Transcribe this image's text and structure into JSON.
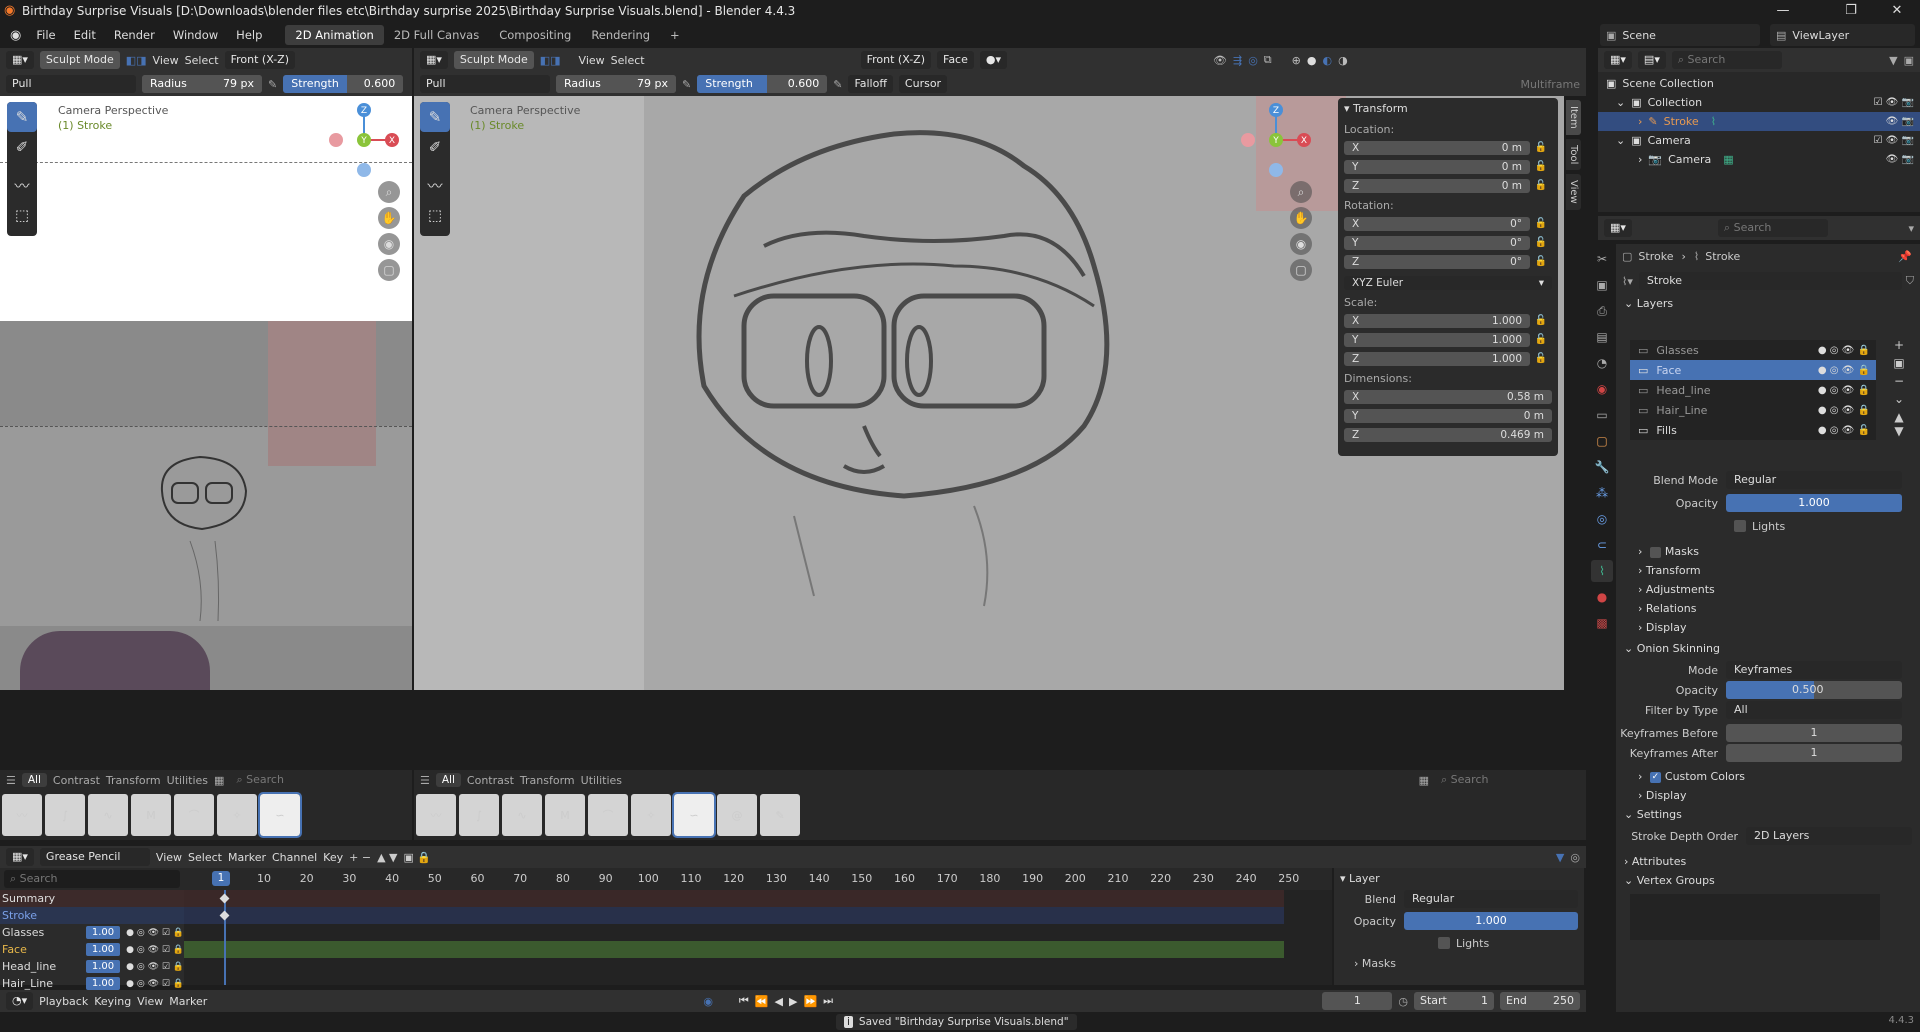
{
  "app": {
    "title": "Birthday Surprise Visuals [D:\\Downloads\\blender files etc\\Birthday surprise 2025\\Birthday Surprise Visuals.blend] - Blender 4.4.3",
    "version": "4.4.3",
    "status_message": "Saved \"Birthday Surprise Visuals.blend\""
  },
  "menu": [
    "File",
    "Edit",
    "Render",
    "Window",
    "Help"
  ],
  "workspaces": [
    {
      "label": "2D Animation",
      "active": true
    },
    {
      "label": "2D Full Canvas",
      "active": false
    },
    {
      "label": "Compositing",
      "active": false
    },
    {
      "label": "Rendering",
      "active": false
    }
  ],
  "scene": {
    "scene_label": "Scene",
    "view_layer_label": "ViewLayer"
  },
  "left_view": {
    "mode": "Sculpt Mode",
    "menus": [
      "View",
      "Select"
    ],
    "orientation": "Front (X-Z)",
    "brush": "Pull",
    "radius_label": "Radius",
    "radius_value": "79 px",
    "strength_label": "Strength",
    "strength_value": "0.600",
    "overlay_title": "Camera Perspective",
    "overlay_sub": "(1) Stroke"
  },
  "main_view": {
    "mode": "Sculpt Mode",
    "menus": [
      "View",
      "Select"
    ],
    "orientation": "Front (X-Z)",
    "face_label": "Face",
    "brush": "Pull",
    "radius_label": "Radius",
    "radius_value": "79 px",
    "strength_label": "Strength",
    "strength_value": "0.600",
    "falloff": "Falloff",
    "cursor": "Cursor",
    "multiframe": "Multiframe",
    "overlay_title": "Camera Perspective",
    "overlay_sub": "(1) Stroke",
    "side_tabs": [
      "Item",
      "Tool",
      "View"
    ]
  },
  "transform": {
    "title": "Transform",
    "location_label": "Location:",
    "location": [
      {
        "axis": "X",
        "value": "0 m"
      },
      {
        "axis": "Y",
        "value": "0 m"
      },
      {
        "axis": "Z",
        "value": "0 m"
      }
    ],
    "rotation_label": "Rotation:",
    "rotation": [
      {
        "axis": "X",
        "value": "0°"
      },
      {
        "axis": "Y",
        "value": "0°"
      },
      {
        "axis": "Z",
        "value": "0°"
      }
    ],
    "rotation_mode": "XYZ Euler",
    "scale_label": "Scale:",
    "scale": [
      {
        "axis": "X",
        "value": "1.000"
      },
      {
        "axis": "Y",
        "value": "1.000"
      },
      {
        "axis": "Z",
        "value": "1.000"
      }
    ],
    "dimensions_label": "Dimensions:",
    "dimensions": [
      {
        "axis": "X",
        "value": "0.58 m"
      },
      {
        "axis": "Y",
        "value": "0 m"
      },
      {
        "axis": "Z",
        "value": "0.469 m"
      }
    ]
  },
  "brush_panel": {
    "filters": [
      "All",
      "Contrast",
      "Transform",
      "Utilities"
    ],
    "search_placeholder": "Search"
  },
  "outliner": {
    "search_placeholder": "Search",
    "items": [
      {
        "label": "Scene Collection",
        "indent": 0
      },
      {
        "label": "Collection",
        "indent": 1
      },
      {
        "label": "Stroke",
        "indent": 2,
        "selected": true
      },
      {
        "label": "Camera",
        "indent": 1
      },
      {
        "label": "Camera",
        "indent": 2
      }
    ]
  },
  "properties": {
    "search_placeholder": "Search",
    "breadcrumb": [
      "Stroke",
      "Stroke"
    ],
    "data_name": "Stroke",
    "layers_title": "Layers",
    "layers": [
      {
        "name": "Glasses",
        "selected": false
      },
      {
        "name": "Face",
        "selected": true
      },
      {
        "name": "Head_line",
        "selected": false
      },
      {
        "name": "Hair_Line",
        "selected": false
      },
      {
        "name": "Fills",
        "selected": false
      }
    ],
    "blend_mode_label": "Blend Mode",
    "blend_mode": "Regular",
    "opacity_label": "Opacity",
    "opacity": "1.000",
    "lights_label": "Lights",
    "subpanels": [
      "Masks",
      "Transform",
      "Adjustments",
      "Relations",
      "Display"
    ],
    "onion_title": "Onion Skinning",
    "onion_mode_label": "Mode",
    "onion_mode": "Keyframes",
    "onion_opacity_label": "Opacity",
    "onion_opacity": "0.500",
    "filter_label": "Filter by Type",
    "filter_value": "All",
    "kf_before_label": "Keyframes Before",
    "kf_before": "1",
    "kf_after_label": "Keyframes After",
    "kf_after": "1",
    "custom_colors": "Custom Colors",
    "onion_display": "Display",
    "settings_title": "Settings",
    "depth_label": "Stroke Depth Order",
    "depth_value": "2D Layers",
    "attributes": "Attributes",
    "vertex_groups": "Vertex Groups"
  },
  "timeline": {
    "editor": "Grease Pencil",
    "menus": [
      "View",
      "Select",
      "Marker",
      "Channel",
      "Key"
    ],
    "search_placeholder": "Search",
    "current_frame": "1",
    "ticks": [
      "10",
      "20",
      "30",
      "40",
      "50",
      "60",
      "70",
      "80",
      "90",
      "100",
      "110",
      "120",
      "130",
      "140",
      "150",
      "160",
      "170",
      "180",
      "190",
      "200",
      "210",
      "220",
      "230",
      "240",
      "250"
    ],
    "channels": [
      {
        "name": "Summary",
        "value": ""
      },
      {
        "name": "Stroke",
        "value": ""
      },
      {
        "name": "Glasses",
        "value": "1.00"
      },
      {
        "name": "Face",
        "value": "1.00"
      },
      {
        "name": "Head_line",
        "value": "1.00"
      },
      {
        "name": "Hair_Line",
        "value": "1.00"
      }
    ],
    "layer_panel_title": "Layer",
    "blend_label": "Blend",
    "blend": "Regular",
    "opacity_label": "Opacity",
    "opacity": "1.000",
    "lights_label": "Lights",
    "masks_label": "Masks"
  },
  "playback": {
    "menus": [
      "Playback",
      "Keying",
      "View",
      "Marker"
    ],
    "frame": "1",
    "start_label": "Start",
    "start": "1",
    "end_label": "End",
    "end": "250"
  }
}
